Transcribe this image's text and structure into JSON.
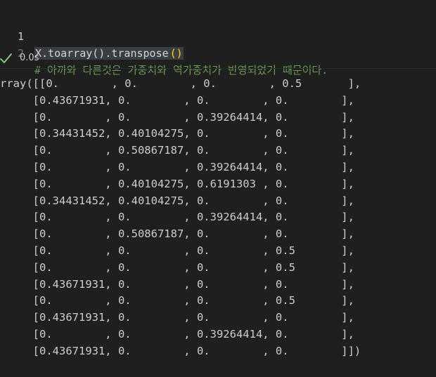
{
  "cell": {
    "lines": [
      {
        "number": "1",
        "code_selected": "X.toarray().transpose",
        "code_parens": "()"
      },
      {
        "number": "2",
        "comment": "# 아까와 다른것은 가중치와 역가중치가 반영되었기 때문이다."
      }
    ]
  },
  "execution": {
    "status": "success",
    "status_icon": "check-icon",
    "time": "0.0s"
  },
  "output": {
    "lines": [
      "rray([[0.        , 0.        , 0.        , 0.5       ],",
      "     [0.43671931, 0.        , 0.        , 0.        ],",
      "     [0.        , 0.        , 0.39264414, 0.        ],",
      "     [0.34431452, 0.40104275, 0.        , 0.        ],",
      "     [0.        , 0.50867187, 0.        , 0.        ],",
      "     [0.        , 0.        , 0.39264414, 0.        ],",
      "     [0.        , 0.40104275, 0.6191303 , 0.        ],",
      "     [0.34431452, 0.40104275, 0.        , 0.        ],",
      "     [0.        , 0.        , 0.39264414, 0.        ],",
      "     [0.        , 0.50867187, 0.        , 0.        ],",
      "     [0.        , 0.        , 0.        , 0.5       ],",
      "     [0.        , 0.        , 0.        , 0.5       ],",
      "     [0.43671931, 0.        , 0.        , 0.        ],",
      "     [0.        , 0.        , 0.        , 0.5       ],",
      "     [0.43671931, 0.        , 0.        , 0.        ],",
      "     [0.        , 0.        , 0.39264414, 0.        ],",
      "     [0.43671931, 0.        , 0.        , 0.        ]])"
    ]
  },
  "colors": {
    "background": "#1f1f1f",
    "text": "#cccccc",
    "comment": "#6a9955",
    "paren": "#ffd700",
    "success": "#89d185",
    "selection": "#3a3d41"
  }
}
